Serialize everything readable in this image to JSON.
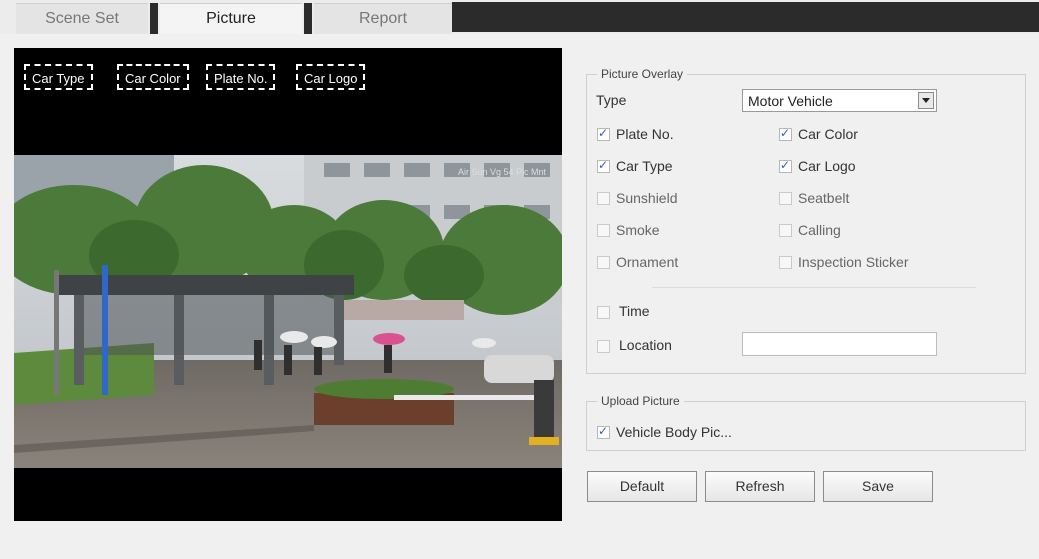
{
  "tabs": [
    {
      "label": "Scene Set",
      "active": false
    },
    {
      "label": "Picture",
      "active": true
    },
    {
      "label": "Report",
      "active": false
    }
  ],
  "video": {
    "overlay_tags": [
      "Car Type",
      "Car Color",
      "Plate No.",
      "Car Logo"
    ],
    "stamp": "Air Sun Vg 54 Pic Mnt"
  },
  "picture_overlay": {
    "legend": "Picture Overlay",
    "type_label": "Type",
    "type_value": "Motor Vehicle",
    "options": [
      {
        "label": "Plate No.",
        "checked": true
      },
      {
        "label": "Car Color",
        "checked": true
      },
      {
        "label": "Car Type",
        "checked": true
      },
      {
        "label": "Car Logo",
        "checked": true
      },
      {
        "label": "Sunshield",
        "checked": false
      },
      {
        "label": "Seatbelt",
        "checked": false
      },
      {
        "label": "Smoke",
        "checked": false
      },
      {
        "label": "Calling",
        "checked": false
      },
      {
        "label": "Ornament",
        "checked": false
      },
      {
        "label": "Inspection Sticker",
        "checked": false
      }
    ],
    "time_label": "Time",
    "time_checked": false,
    "location_label": "Location",
    "location_checked": false,
    "location_value": ""
  },
  "upload_picture": {
    "legend": "Upload Picture",
    "vehicle_body_label": "Vehicle Body Pic...",
    "vehicle_body_checked": true
  },
  "buttons": {
    "default": "Default",
    "refresh": "Refresh",
    "save": "Save"
  },
  "colors": {
    "checkbox_mark": "#2b5fb6",
    "tab_bar_dark": "#2b2b2b"
  }
}
